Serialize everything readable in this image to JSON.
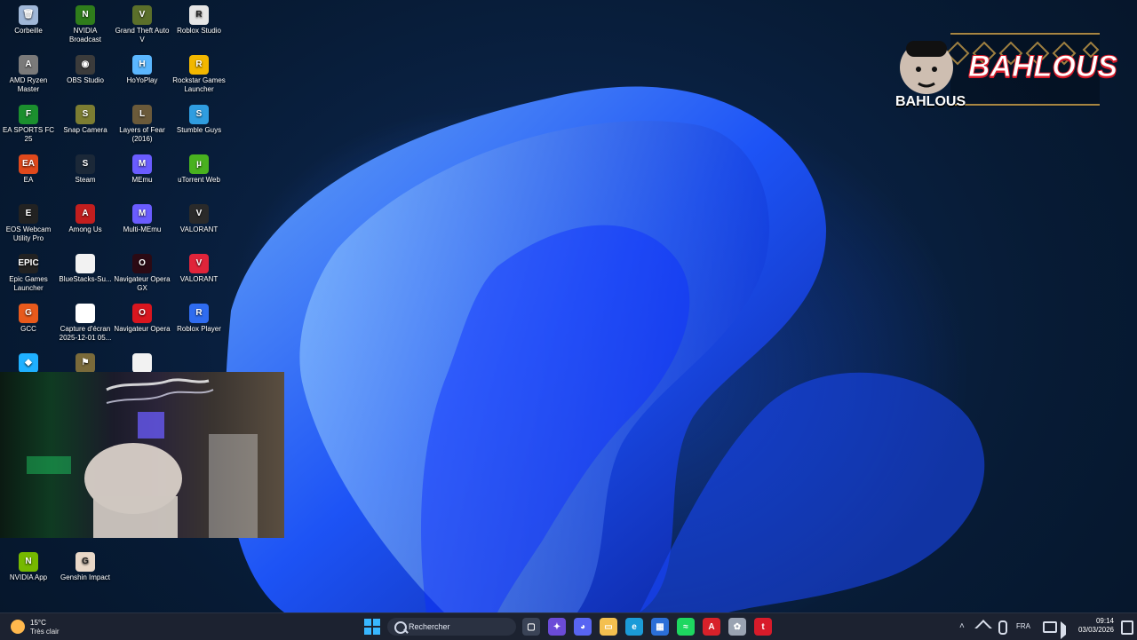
{
  "desktop": {
    "icons": [
      {
        "label": "Corbeille",
        "icon": "recycle-bin-icon",
        "color": "#9fb7d8",
        "glyph": "🗑"
      },
      {
        "label": "NVIDIA Broadcast",
        "icon": "nvidia-broadcast-icon",
        "color": "#2f7d1b",
        "glyph": "N"
      },
      {
        "label": "Grand Theft Auto V",
        "icon": "gta-icon",
        "color": "#5b6f2a",
        "glyph": "V"
      },
      {
        "label": "Roblox Studio",
        "icon": "roblox-studio-icon",
        "color": "#e6e6e6",
        "glyph": "R"
      },
      {
        "label": "AMD Ryzen Master",
        "icon": "amd-ryzen-icon",
        "color": "#7a7a7a",
        "glyph": "A"
      },
      {
        "label": "OBS Studio",
        "icon": "obs-icon",
        "color": "#3b3b3b",
        "glyph": "◉"
      },
      {
        "label": "HoYoPlay",
        "icon": "hoyoplay-icon",
        "color": "#5bb7ff",
        "glyph": "H"
      },
      {
        "label": "Rockstar Games Launcher",
        "icon": "rockstar-icon",
        "color": "#f2b700",
        "glyph": "R"
      },
      {
        "label": "EA SPORTS FC 25",
        "icon": "ea-fc-icon",
        "color": "#1b8f2e",
        "glyph": "F"
      },
      {
        "label": "Snap Camera",
        "icon": "snap-camera-icon",
        "color": "#7c7d32",
        "glyph": "S"
      },
      {
        "label": "Layers of Fear (2016)",
        "icon": "layers-of-fear-icon",
        "color": "#6b5a3a",
        "glyph": "L"
      },
      {
        "label": "Stumble Guys",
        "icon": "stumble-guys-icon",
        "color": "#2f9de0",
        "glyph": "S"
      },
      {
        "label": "EA",
        "icon": "ea-icon",
        "color": "#e0491c",
        "glyph": "EA"
      },
      {
        "label": "Steam",
        "icon": "steam-icon",
        "color": "#1b2838",
        "glyph": "S"
      },
      {
        "label": "MEmu",
        "icon": "memu-icon",
        "color": "#6a5cff",
        "glyph": "M"
      },
      {
        "label": "uTorrent Web",
        "icon": "utorrent-icon",
        "color": "#49b21f",
        "glyph": "µ"
      },
      {
        "label": "EOS Webcam Utility Pro",
        "icon": "eos-webcam-icon",
        "color": "#222222",
        "glyph": "E"
      },
      {
        "label": "Among Us",
        "icon": "among-us-icon",
        "color": "#c21e1e",
        "glyph": "A"
      },
      {
        "label": "Multi-MEmu",
        "icon": "multi-memu-icon",
        "color": "#6a5cff",
        "glyph": "M"
      },
      {
        "label": "VALORANT",
        "icon": "valorant-icon",
        "color": "#2a2a2a",
        "glyph": "V"
      },
      {
        "label": "Epic Games Launcher",
        "icon": "epic-games-icon",
        "color": "#222222",
        "glyph": "EPIC"
      },
      {
        "label": "BlueStacks-Su...",
        "icon": "file-icon",
        "color": "#f2f2f2",
        "glyph": ""
      },
      {
        "label": "Navigateur Opera GX",
        "icon": "opera-gx-icon",
        "color": "#2b0a14",
        "glyph": "O"
      },
      {
        "label": "VALORANT",
        "icon": "valorant-icon",
        "color": "#e0243a",
        "glyph": "V"
      },
      {
        "label": "GCC",
        "icon": "gcc-icon",
        "color": "#e85a1c",
        "glyph": "G"
      },
      {
        "label": "Capture d'écran 2025-12-01 05...",
        "icon": "screenshot-file-icon",
        "color": "#ffffff",
        "glyph": ""
      },
      {
        "label": "Navigateur Opera",
        "icon": "opera-icon",
        "color": "#d9161f",
        "glyph": "O"
      },
      {
        "label": "Roblox Player",
        "icon": "roblox-player-icon",
        "color": "#2f6cf0",
        "glyph": "R"
      },
      {
        "label": "",
        "icon": "bluestacks-icon",
        "color": "#1fb0ff",
        "glyph": "◆"
      },
      {
        "label": "",
        "icon": "game-launcher-icon",
        "color": "#7a6a3a",
        "glyph": "⚑"
      },
      {
        "label": "",
        "icon": "file-icon",
        "color": "#f2f2f2",
        "glyph": ""
      },
      {
        "label": "NVIDIA App",
        "icon": "nvidia-app-icon",
        "color": "#76b900",
        "glyph": "N"
      },
      {
        "label": "Genshin Impact",
        "icon": "genshin-impact-icon",
        "color": "#e9d8c8",
        "glyph": "G"
      }
    ]
  },
  "overlay": {
    "logo_text": "BAHLOUS",
    "logo_subtext": "BAHLOUS"
  },
  "taskbar": {
    "weather": {
      "temp": "15°C",
      "condition": "Très clair"
    },
    "search_placeholder": "Rechercher",
    "language": "FRA",
    "time": "09:14",
    "date": "03/03/2026",
    "apps": [
      {
        "name": "task-view-icon",
        "color": "#3a4356",
        "glyph": "▢"
      },
      {
        "name": "copilot-icon",
        "color": "#6b4bd8",
        "glyph": "✦"
      },
      {
        "name": "discord-icon",
        "color": "#5865f2",
        "glyph": "◕"
      },
      {
        "name": "file-explorer-icon",
        "color": "#f4c04f",
        "glyph": "▭"
      },
      {
        "name": "edge-icon",
        "color": "#1b9bd8",
        "glyph": "e"
      },
      {
        "name": "microsoft-store-icon",
        "color": "#2b6fd8",
        "glyph": "▦"
      },
      {
        "name": "spotify-icon",
        "color": "#1ed760",
        "glyph": "≈"
      },
      {
        "name": "adobe-icon",
        "color": "#d8212a",
        "glyph": "A"
      },
      {
        "name": "app-icon",
        "color": "#9aa3b2",
        "glyph": "✿"
      },
      {
        "name": "tiktok-live-icon",
        "color": "#d81b2a",
        "glyph": "t"
      }
    ]
  }
}
